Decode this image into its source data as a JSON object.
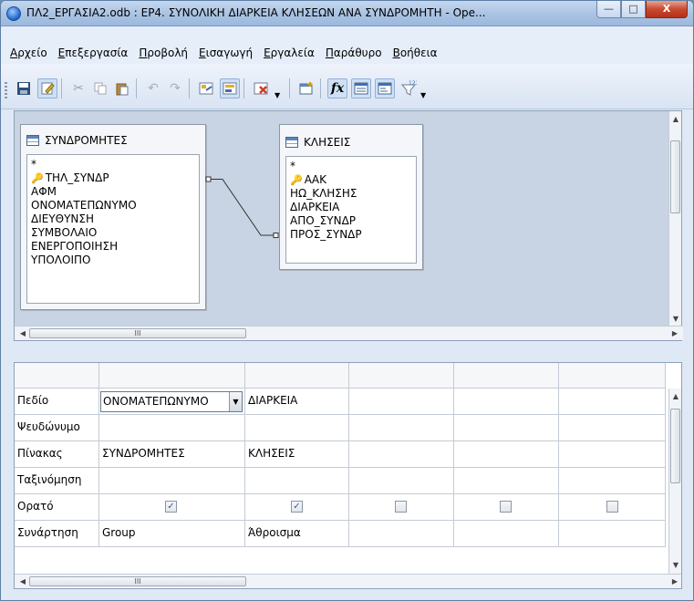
{
  "window": {
    "title": "ΠΛ2_ΕΡΓΑΣΙΑ2.odb : ΕΡ4. ΣΥΝΟΛΙΚΗ ΔΙΑΡΚΕΙΑ ΚΛΗΣΕΩΝ ΑΝΑ ΣΥΝΔΡΟΜΗΤΗ - Ope...",
    "minimize": "—",
    "maximize": "□",
    "close": "X"
  },
  "menu": [
    {
      "label": "Αρχείο"
    },
    {
      "label": "Επεξεργασία"
    },
    {
      "label": "Προβολή"
    },
    {
      "label": "Εισαγωγή"
    },
    {
      "label": "Εργαλεία"
    },
    {
      "label": "Παράθυρο"
    },
    {
      "label": "Βοήθεια"
    }
  ],
  "toolbar": {
    "icons": [
      "save-icon",
      "edit-icon",
      "cut-icon",
      "copy-icon",
      "paste-icon",
      "undo-icon",
      "redo-icon",
      "design-view-icon",
      "sql-view-icon",
      "delete-icon",
      "add-table-icon",
      "functions-icon",
      "table-names-icon",
      "alias-icon",
      "distinct-icon"
    ],
    "func_label": "fx",
    "distinct_label": "123"
  },
  "tables": [
    {
      "name": "ΣΥΝΔΡΟΜΗΤΕΣ",
      "fields": [
        {
          "name": "*",
          "key": false
        },
        {
          "name": "ΤΗΛ_ΣΥΝΔΡ",
          "key": true
        },
        {
          "name": "ΑΦΜ",
          "key": false
        },
        {
          "name": "ΟΝΟΜΑΤΕΠΩΝΥΜΟ",
          "key": false
        },
        {
          "name": "ΔΙΕΥΘΥΝΣΗ",
          "key": false
        },
        {
          "name": "ΣΥΜΒΟΛΑΙΟ",
          "key": false
        },
        {
          "name": "ΕΝΕΡΓΟΠΟΙΗΣΗ",
          "key": false
        },
        {
          "name": "ΥΠΟΛΟΙΠΟ",
          "key": false
        }
      ]
    },
    {
      "name": "ΚΛΗΣΕΙΣ",
      "fields": [
        {
          "name": "*",
          "key": false
        },
        {
          "name": "ΑΑΚ",
          "key": true
        },
        {
          "name": "ΗΩ_ΚΛΗΣΗΣ",
          "key": false
        },
        {
          "name": "ΔΙΑΡΚΕΙΑ",
          "key": false
        },
        {
          "name": "ΑΠΟ_ΣΥΝΔΡ",
          "key": false
        },
        {
          "name": "ΠΡΟΣ_ΣΥΝΔΡ",
          "key": false
        }
      ]
    }
  ],
  "hscroll_thumb_text": "III",
  "grid": {
    "row_labels": [
      "Πεδίο",
      "Ψευδώνυμο",
      "Πίνακας",
      "Ταξινόμηση",
      "Ορατό",
      "Συνάρτηση"
    ],
    "columns": [
      {
        "field": "ΟΝΟΜΑΤΕΠΩΝΥΜΟ",
        "alias": "",
        "table": "ΣΥΝΔΡΟΜΗΤΕΣ",
        "sort": "",
        "visible": true,
        "function": "Group"
      },
      {
        "field": "ΔΙΑΡΚΕΙΑ",
        "alias": "",
        "table": "ΚΛΗΣΕΙΣ",
        "sort": "",
        "visible": true,
        "function": "Άθροισμα"
      },
      {
        "field": "",
        "alias": "",
        "table": "",
        "sort": "",
        "visible": false,
        "function": ""
      },
      {
        "field": "",
        "alias": "",
        "table": "",
        "sort": "",
        "visible": false,
        "function": ""
      },
      {
        "field": "",
        "alias": "",
        "table": "",
        "sort": "",
        "visible": false,
        "function": ""
      }
    ],
    "check_mark": "✓"
  },
  "colors": {
    "titlebar": "#a9c3e3",
    "design_bg": "#c8d4e3",
    "close_button": "#c74a32",
    "key_icon": "#c79a16"
  }
}
